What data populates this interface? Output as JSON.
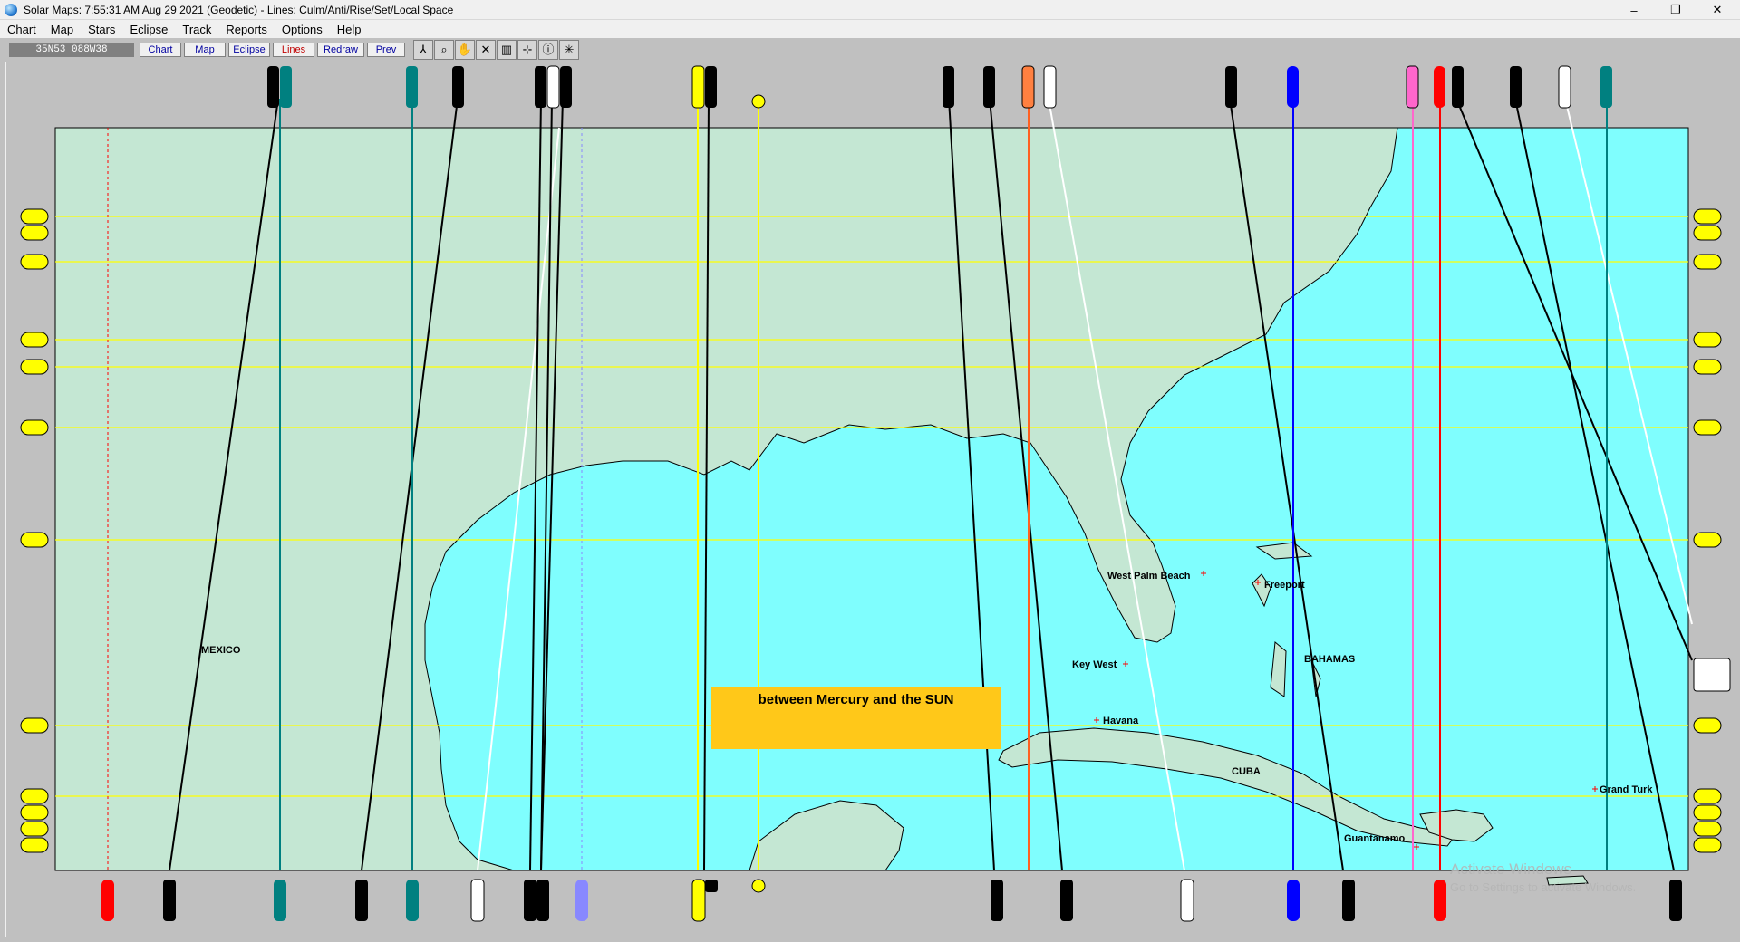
{
  "window": {
    "title": "Solar Maps: 7:55:31 AM Aug 29 2021 (Geodetic) - Lines: Culm/Anti/Rise/Set/Local Space",
    "controls": [
      "–",
      "❐",
      "✕"
    ]
  },
  "menu": [
    "Chart",
    "Map",
    "Stars",
    "Eclipse",
    "Track",
    "Reports",
    "Options",
    "Help"
  ],
  "toolbar": {
    "coordinates": "35N53  088W38",
    "buttons": [
      {
        "label": "Chart",
        "color": "#0000a0"
      },
      {
        "label": "Map",
        "color": "#0000a0"
      },
      {
        "label": "Eclipse",
        "color": "#0000a0"
      },
      {
        "label": "Lines",
        "color": "#c00000"
      },
      {
        "label": "Redraw",
        "color": "#0000a0"
      },
      {
        "label": "Prev",
        "color": "#0000a0"
      }
    ],
    "tools": [
      "line-tool-icon",
      "zoom-icon",
      "hand-icon",
      "cross-out-icon",
      "panel-icon",
      "grid-icon",
      "info-icon",
      "crosshair-icon"
    ]
  },
  "map": {
    "colors": {
      "ocean": "#7ffefe",
      "land": "#c4e7d3",
      "coast": "#000000",
      "parallel": "#ffff00"
    },
    "region_labels": [
      "MEXICO",
      "CUBA",
      "BAHAMAS"
    ],
    "cities": [
      "West Palm Beach",
      "Freeport",
      "Key West",
      "Havana",
      "Grand Turk",
      "Guantanamo"
    ],
    "callout": "between Mercury and the SUN"
  },
  "watermark": {
    "line1": "Activate Windows",
    "line2": "Go to Settings to activate Windows."
  }
}
